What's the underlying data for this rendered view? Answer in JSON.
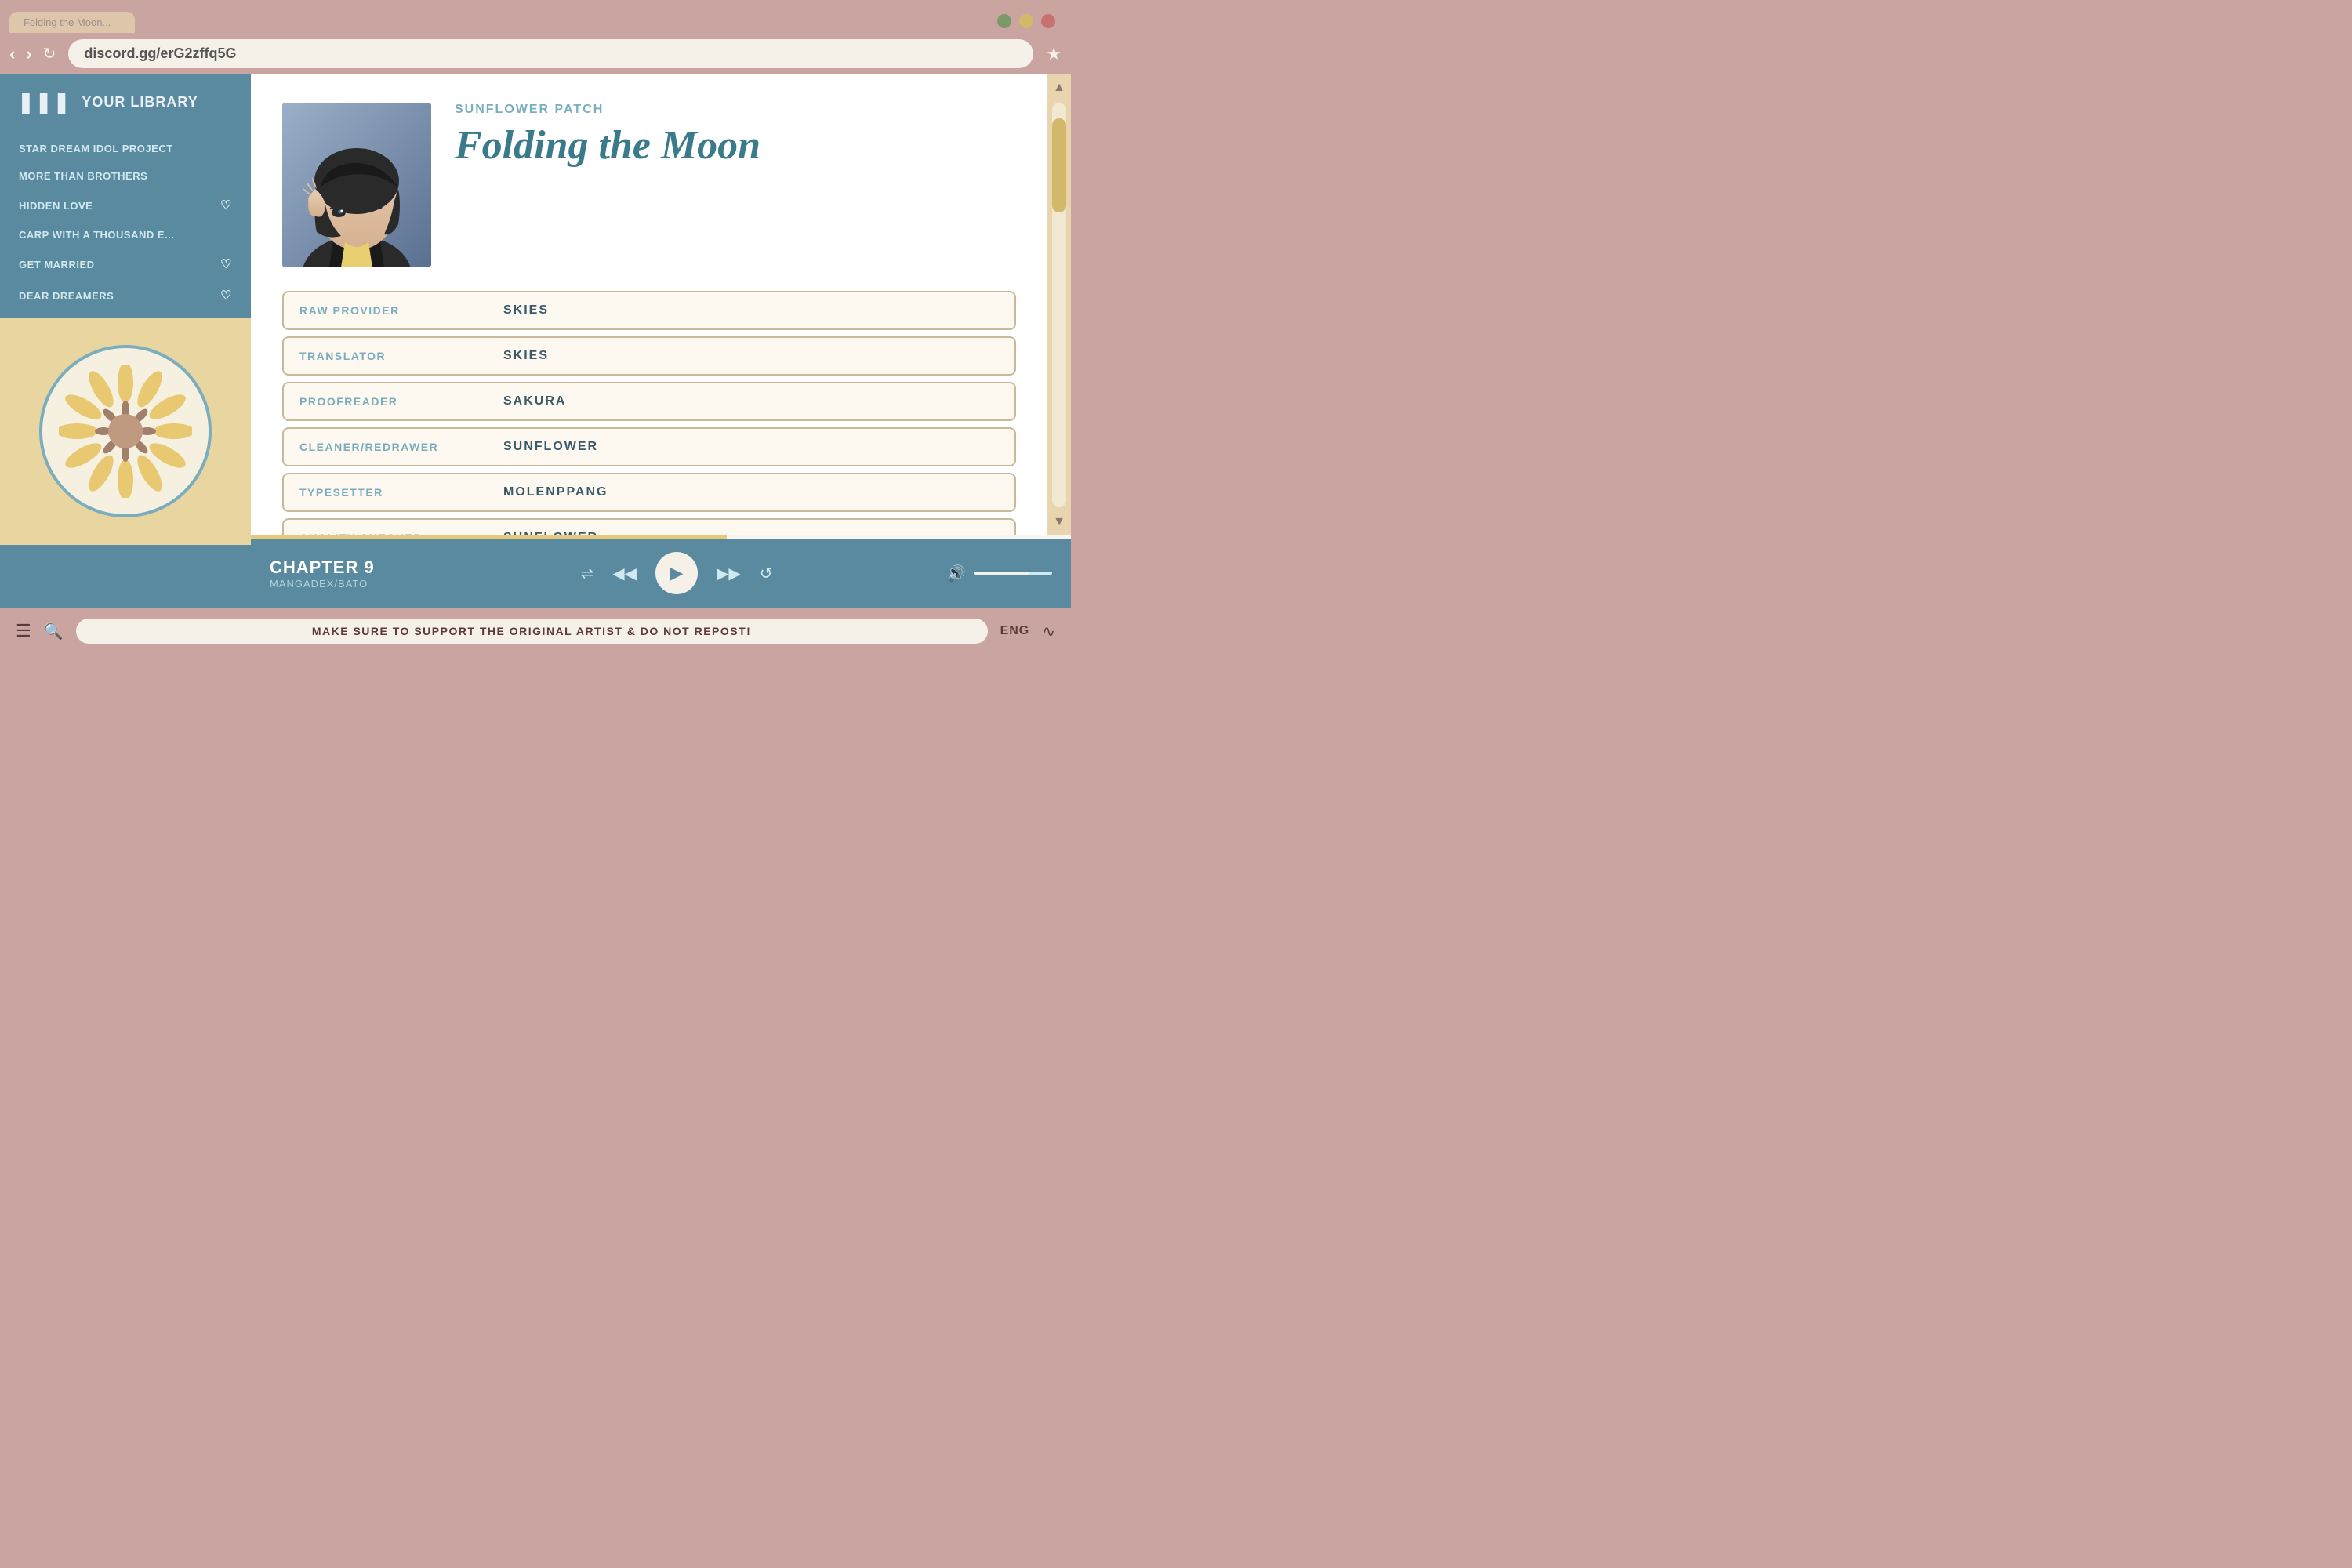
{
  "browser": {
    "url": "discord.gg/erG2zffq5G",
    "tabs": [
      {
        "label": "Folding the Moon...",
        "active": false
      },
      {
        "label": "+",
        "is_new": true
      }
    ],
    "window_controls": {
      "min_color": "#7a9a6a",
      "max_color": "#d4b86a",
      "close_color": "#c97070"
    }
  },
  "sidebar": {
    "header": "YOUR LIBRARY",
    "library_icon": "|||",
    "items": [
      {
        "label": "STAR DREAM IDOL PROJECT",
        "has_heart": false
      },
      {
        "label": "MORE THAN BROTHERS",
        "has_heart": false
      },
      {
        "label": "HIDDEN LOVE",
        "has_heart": true
      },
      {
        "label": "CARP WITH A THOUSAND E...",
        "has_heart": false
      },
      {
        "label": "GET MARRIED",
        "has_heart": true
      },
      {
        "label": "DEAR DREAMERS",
        "has_heart": true
      }
    ]
  },
  "manga": {
    "series_name": "SUNFLOWER PATCH",
    "title": "Folding the Moon",
    "credits": [
      {
        "label": "RAW PROVIDER",
        "value": "SKIES"
      },
      {
        "label": "TRANSLATOR",
        "value": "SKIES"
      },
      {
        "label": "PROOFREADER",
        "value": "SAKURA"
      },
      {
        "label": "CLEANER/REDRAWER",
        "value": "SUNFLOWER"
      },
      {
        "label": "TYPESETTER",
        "value": "MOLENPPANG"
      },
      {
        "label": "QUALITY CHECKER",
        "value": "SUNFLOWER"
      }
    ]
  },
  "player": {
    "chapter_label": "CHAPTER 9",
    "source": "MANGADEX/BATO",
    "controls": {
      "shuffle": "⇄",
      "prev": "◀◀",
      "play": "▶",
      "next": "▶▶",
      "repeat": "↺"
    },
    "progress_percent": 58,
    "volume_percent": 70
  },
  "bottom_bar": {
    "notice": "MAKE SURE TO SUPPORT THE ORIGINAL ARTIST & DO NOT REPOST!",
    "language": "ENG"
  }
}
